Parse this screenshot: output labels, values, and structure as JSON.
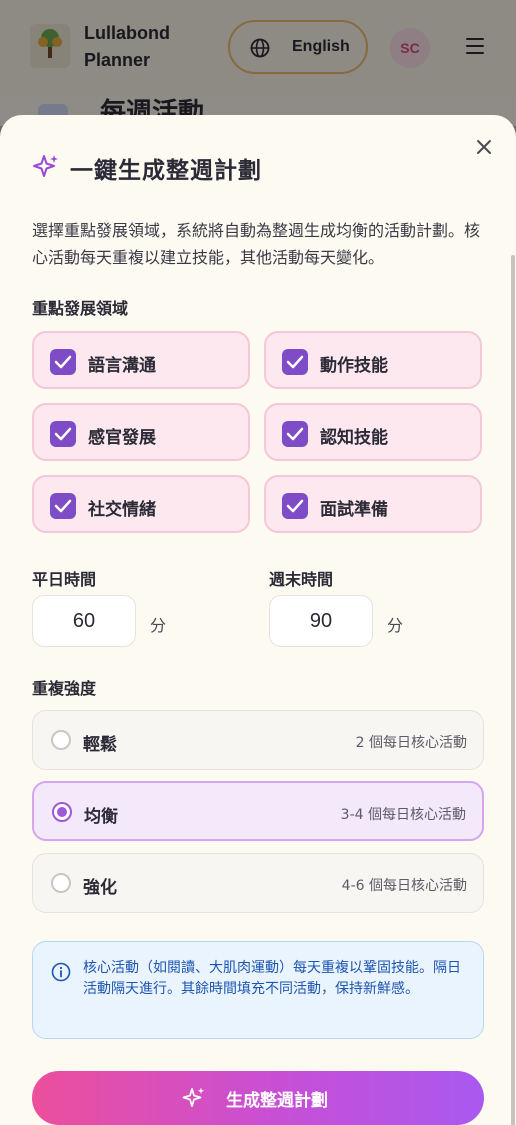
{
  "app": {
    "title": "Lullabond Planner",
    "language": "English",
    "avatar": "SC",
    "section_title": "每週活動"
  },
  "modal": {
    "title": "一鍵生成整週計劃",
    "description": "選擇重點發展領域，系統將自動為整週生成均衡的活動計劃。核心活動每天重複以建立技能，其他活動每天變化。",
    "areas_label": "重點發展領域",
    "areas": [
      {
        "label": "語言溝通",
        "checked": true
      },
      {
        "label": "動作技能",
        "checked": true
      },
      {
        "label": "感官發展",
        "checked": true
      },
      {
        "label": "認知技能",
        "checked": true
      },
      {
        "label": "社交情緒",
        "checked": true
      },
      {
        "label": "面試準備",
        "checked": true
      }
    ],
    "weekday": {
      "label": "平日時間",
      "value": "60",
      "unit": "分"
    },
    "weekend": {
      "label": "週末時間",
      "value": "90",
      "unit": "分"
    },
    "intensity_label": "重複強度",
    "intensity_options": [
      {
        "label": "輕鬆",
        "desc": "2 個每日核心活動",
        "selected": false
      },
      {
        "label": "均衡",
        "desc": "3-4 個每日核心活動",
        "selected": true
      },
      {
        "label": "強化",
        "desc": "4-6 個每日核心活動",
        "selected": false
      }
    ],
    "info": "核心活動（如閱讀、大肌肉運動）每天重複以鞏固技能。隔日活動隔天進行。其餘時間填充不同活動，保持新鮮感。",
    "generate_label": "生成整週計劃"
  },
  "colors": {
    "accent_purple": "#7e4cc7",
    "card_pink": "#fde8ef",
    "info_blue": "#1d55b0"
  }
}
